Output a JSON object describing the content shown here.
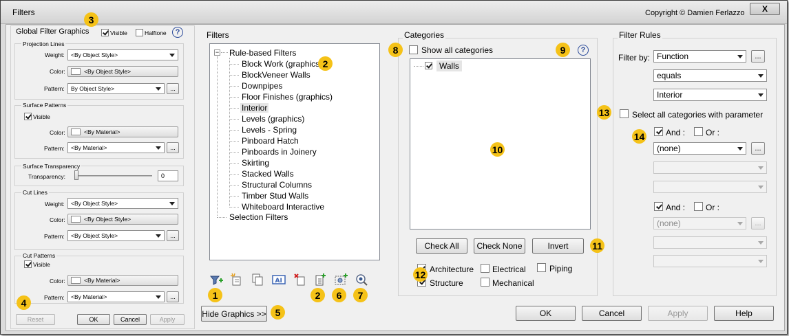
{
  "window": {
    "title": "Filters",
    "copyright": "Copyright © Damien Ferlazzo",
    "close_label": "X"
  },
  "global_graphics": {
    "title": "Global Filter Graphics",
    "visible_label": "Visible",
    "visible_checked": true,
    "halftone_label": "Halftone",
    "halftone_checked": false,
    "help_icon": "question-icon",
    "projection_lines": {
      "heading": "Projection Lines",
      "weight_label": "Weight:",
      "weight_value": "<By Object Style>",
      "color_label": "Color:",
      "color_value": "<By Object Style>",
      "pattern_label": "Pattern:",
      "pattern_value": "By Object Style>",
      "more": "..."
    },
    "surface_patterns": {
      "heading": "Surface Patterns",
      "visible_label": "Visible",
      "visible_checked": true,
      "color_label": "Color:",
      "color_value": "<By Material>",
      "pattern_label": "Pattern:",
      "pattern_value": "<By Material>",
      "more": "..."
    },
    "surface_transparency": {
      "heading": "Surface Transparency",
      "transparency_label": "Transparency:",
      "transparency_value": "0",
      "level": 0
    },
    "cut_lines": {
      "heading": "Cut Lines",
      "weight_label": "Weight:",
      "weight_value": "<By Object Style>",
      "color_label": "Color:",
      "color_value": "<By Object Style>",
      "pattern_label": "Pattern:",
      "pattern_value": "<By Object Style>",
      "more": "..."
    },
    "cut_patterns": {
      "heading": "Cut Patterns",
      "visible_label": "Visible",
      "visible_checked": true,
      "color_label": "Color:",
      "color_value": "<By Material>",
      "pattern_label": "Pattern:",
      "pattern_value": "<By Material>",
      "more": "..."
    },
    "buttons": {
      "reset": "Reset",
      "ok": "OK",
      "cancel": "Cancel",
      "apply": "Apply"
    }
  },
  "filters": {
    "heading": "Filters",
    "root_label": "Rule-based Filters",
    "items": [
      "Block Work (graphics)",
      "BlockVeneer Walls",
      "Downpipes",
      "Floor Finishes (graphics)",
      "Interior",
      "Levels (graphics)",
      "Levels - Spring",
      "Pinboard Hatch",
      "Pinboards in Joinery",
      "Skirting",
      "Stacked Walls",
      "Structural Columns",
      "Timber Stud Walls",
      "Whiteboard Interactive"
    ],
    "selected_item": "Interior",
    "selection_filters": "Selection Filters",
    "toolbar_icons": [
      "new-filter-icon",
      "new-rule-icon",
      "duplicate-icon",
      "rename-icon",
      "delete-icon",
      "add-to-selection-icon",
      "edit-selection-icon",
      "select-elements-icon"
    ],
    "hide_graphics_label": "Hide Graphics >>"
  },
  "categories": {
    "heading": "Categories",
    "show_all_label": "Show all categories",
    "show_all_checked": false,
    "help_icon": "question-icon",
    "list": [
      {
        "label": "Walls",
        "checked": true
      }
    ],
    "check_all": "Check All",
    "check_none": "Check None",
    "invert": "Invert",
    "disciplines": [
      {
        "label": "Architecture",
        "checked": true
      },
      {
        "label": "Electrical",
        "checked": false
      },
      {
        "label": "Piping",
        "checked": false
      },
      {
        "label": "Structure",
        "checked": true
      },
      {
        "label": "Mechanical",
        "checked": false
      }
    ]
  },
  "rules": {
    "heading": "Filter Rules",
    "filter_by_label": "Filter by:",
    "parameter": "Function",
    "operator": "equals",
    "value": "Interior",
    "more": "...",
    "select_all_label": "Select all categories with parameter",
    "select_all_checked": false,
    "group1": {
      "and_label": "And :",
      "and_checked": true,
      "or_label": "Or :",
      "or_checked": false,
      "parameter": "(none)",
      "more": "..."
    },
    "group2": {
      "and_label": "And :",
      "and_checked": true,
      "or_label": "Or :",
      "or_checked": false,
      "parameter": "(none)",
      "more": "..."
    }
  },
  "bottom_buttons": {
    "ok": "OK",
    "cancel": "Cancel",
    "apply": "Apply",
    "help": "Help"
  },
  "markers": [
    "1",
    "2",
    "2",
    "3",
    "4",
    "5",
    "6",
    "7",
    "8",
    "9",
    "10",
    "11",
    "12",
    "13",
    "14"
  ],
  "colors": {
    "marker": "#f5c218",
    "selection": "#e5e5e5",
    "help_blue": "#2a4a9a"
  }
}
